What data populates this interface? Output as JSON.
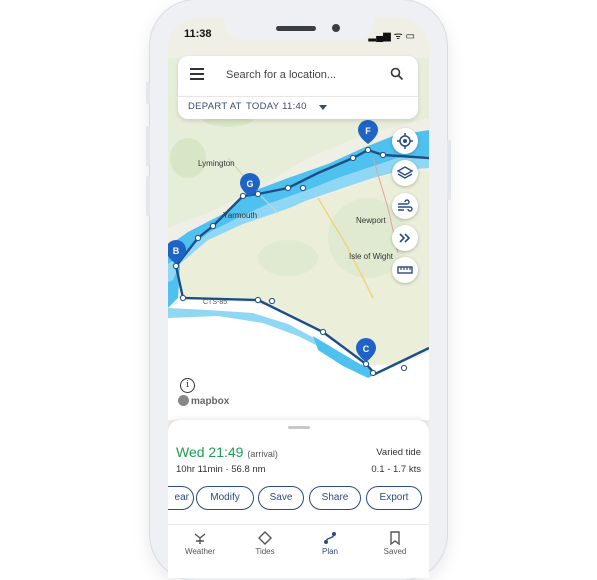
{
  "status": {
    "time": "11:38",
    "icons": "▂▄▆ ᯤ ▭"
  },
  "search": {
    "placeholder": "Search for a location..."
  },
  "depart": {
    "label": "DEPART AT",
    "value": "TODAY 11:40"
  },
  "map": {
    "places": [
      "Lymington",
      "Yarmouth",
      "Newport",
      "Isle of Wight",
      "CTS-85"
    ],
    "waypoints": [
      "B",
      "G",
      "F",
      "C"
    ],
    "attribution": "mapbox",
    "info": "i"
  },
  "route": {
    "arrival_time": "Wed 21:49",
    "arrival_note": "(arrival)",
    "duration": "10hr 11min · 56.8 nm",
    "tide_label": "Varied tide",
    "tide_range": "0.1 - 1.7 kts"
  },
  "actions": [
    "ear",
    "Modify",
    "Save",
    "Share",
    "Export"
  ],
  "nav": [
    "Weather",
    "Tides",
    "Plan",
    "Saved"
  ],
  "colors": {
    "route": "#1d4f86",
    "water": "#4fc1f0",
    "active": "#2b4a86",
    "arrival": "#1f9d55"
  }
}
